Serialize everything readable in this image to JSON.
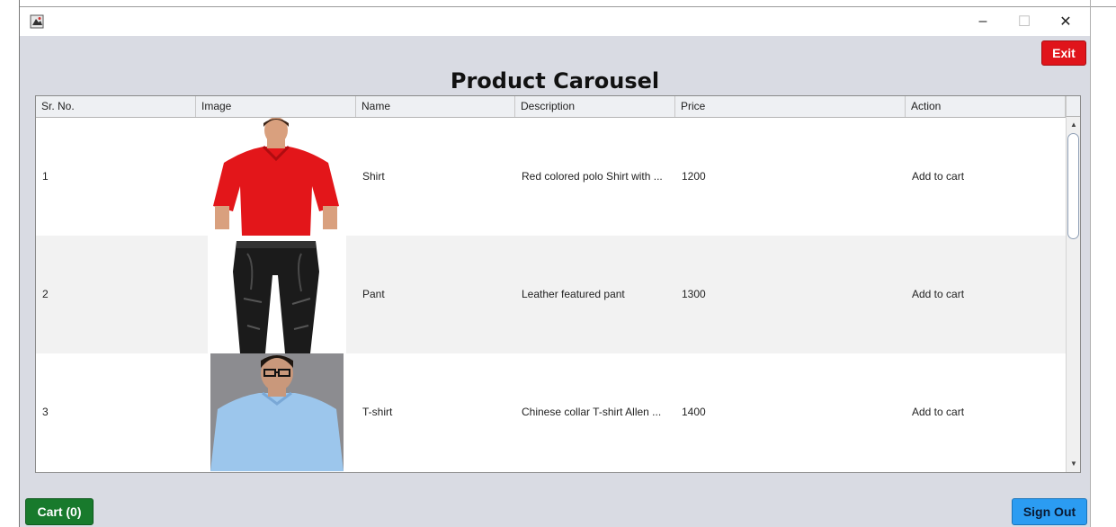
{
  "window": {
    "icon": "java-app-icon",
    "controls": {
      "minimize": "–",
      "maximize": "☐",
      "close": "✕"
    }
  },
  "header": {
    "exit_label": "Exit",
    "title": "Product Carousel"
  },
  "table": {
    "columns": [
      "Sr. No.",
      "Image",
      "Name",
      "Description",
      "Price",
      "Action"
    ],
    "rows": [
      {
        "sr": "1",
        "image": "red-polo-shirt-photo",
        "name": "Shirt",
        "description": "Red colored polo Shirt with ...",
        "price": "1200",
        "action": "Add to cart"
      },
      {
        "sr": "2",
        "image": "leather-pant-photo",
        "name": "Pant",
        "description": "Leather featured pant",
        "price": "1300",
        "action": "Add to cart"
      },
      {
        "sr": "3",
        "image": "blue-tshirt-photo",
        "name": "T-shirt",
        "description": "Chinese collar T-shirt Allen ...",
        "price": "1400",
        "action": "Add to cart"
      }
    ]
  },
  "footer": {
    "cart_label": "Cart (0)",
    "signout_label": "Sign Out"
  },
  "colors": {
    "exit": "#e0141b",
    "cart": "#187a2c",
    "signout": "#2b9cf2",
    "window_bg": "#d9dbe3"
  }
}
